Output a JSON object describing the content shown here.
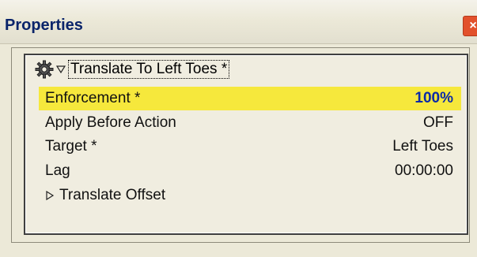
{
  "window": {
    "title": "Properties",
    "close_label": "×"
  },
  "panel": {
    "header_label": "Translate To Left Toes *",
    "rows": [
      {
        "name": "Enforcement *",
        "value": "100%"
      },
      {
        "name": "Apply Before Action",
        "value": "OFF"
      },
      {
        "name": "Target *",
        "value": "Left Toes"
      },
      {
        "name": "Lag",
        "value": "00:00:00"
      },
      {
        "name": "Translate Offset",
        "value": ""
      }
    ]
  },
  "colors": {
    "highlight": "#f6e83c",
    "highlight_value": "#0b2aa8",
    "close_button": "#e2512c"
  },
  "icons": {
    "gear": "gear-icon",
    "dropdown": "chevron-down-icon",
    "expand": "triangle-right-icon",
    "close": "close-icon"
  }
}
